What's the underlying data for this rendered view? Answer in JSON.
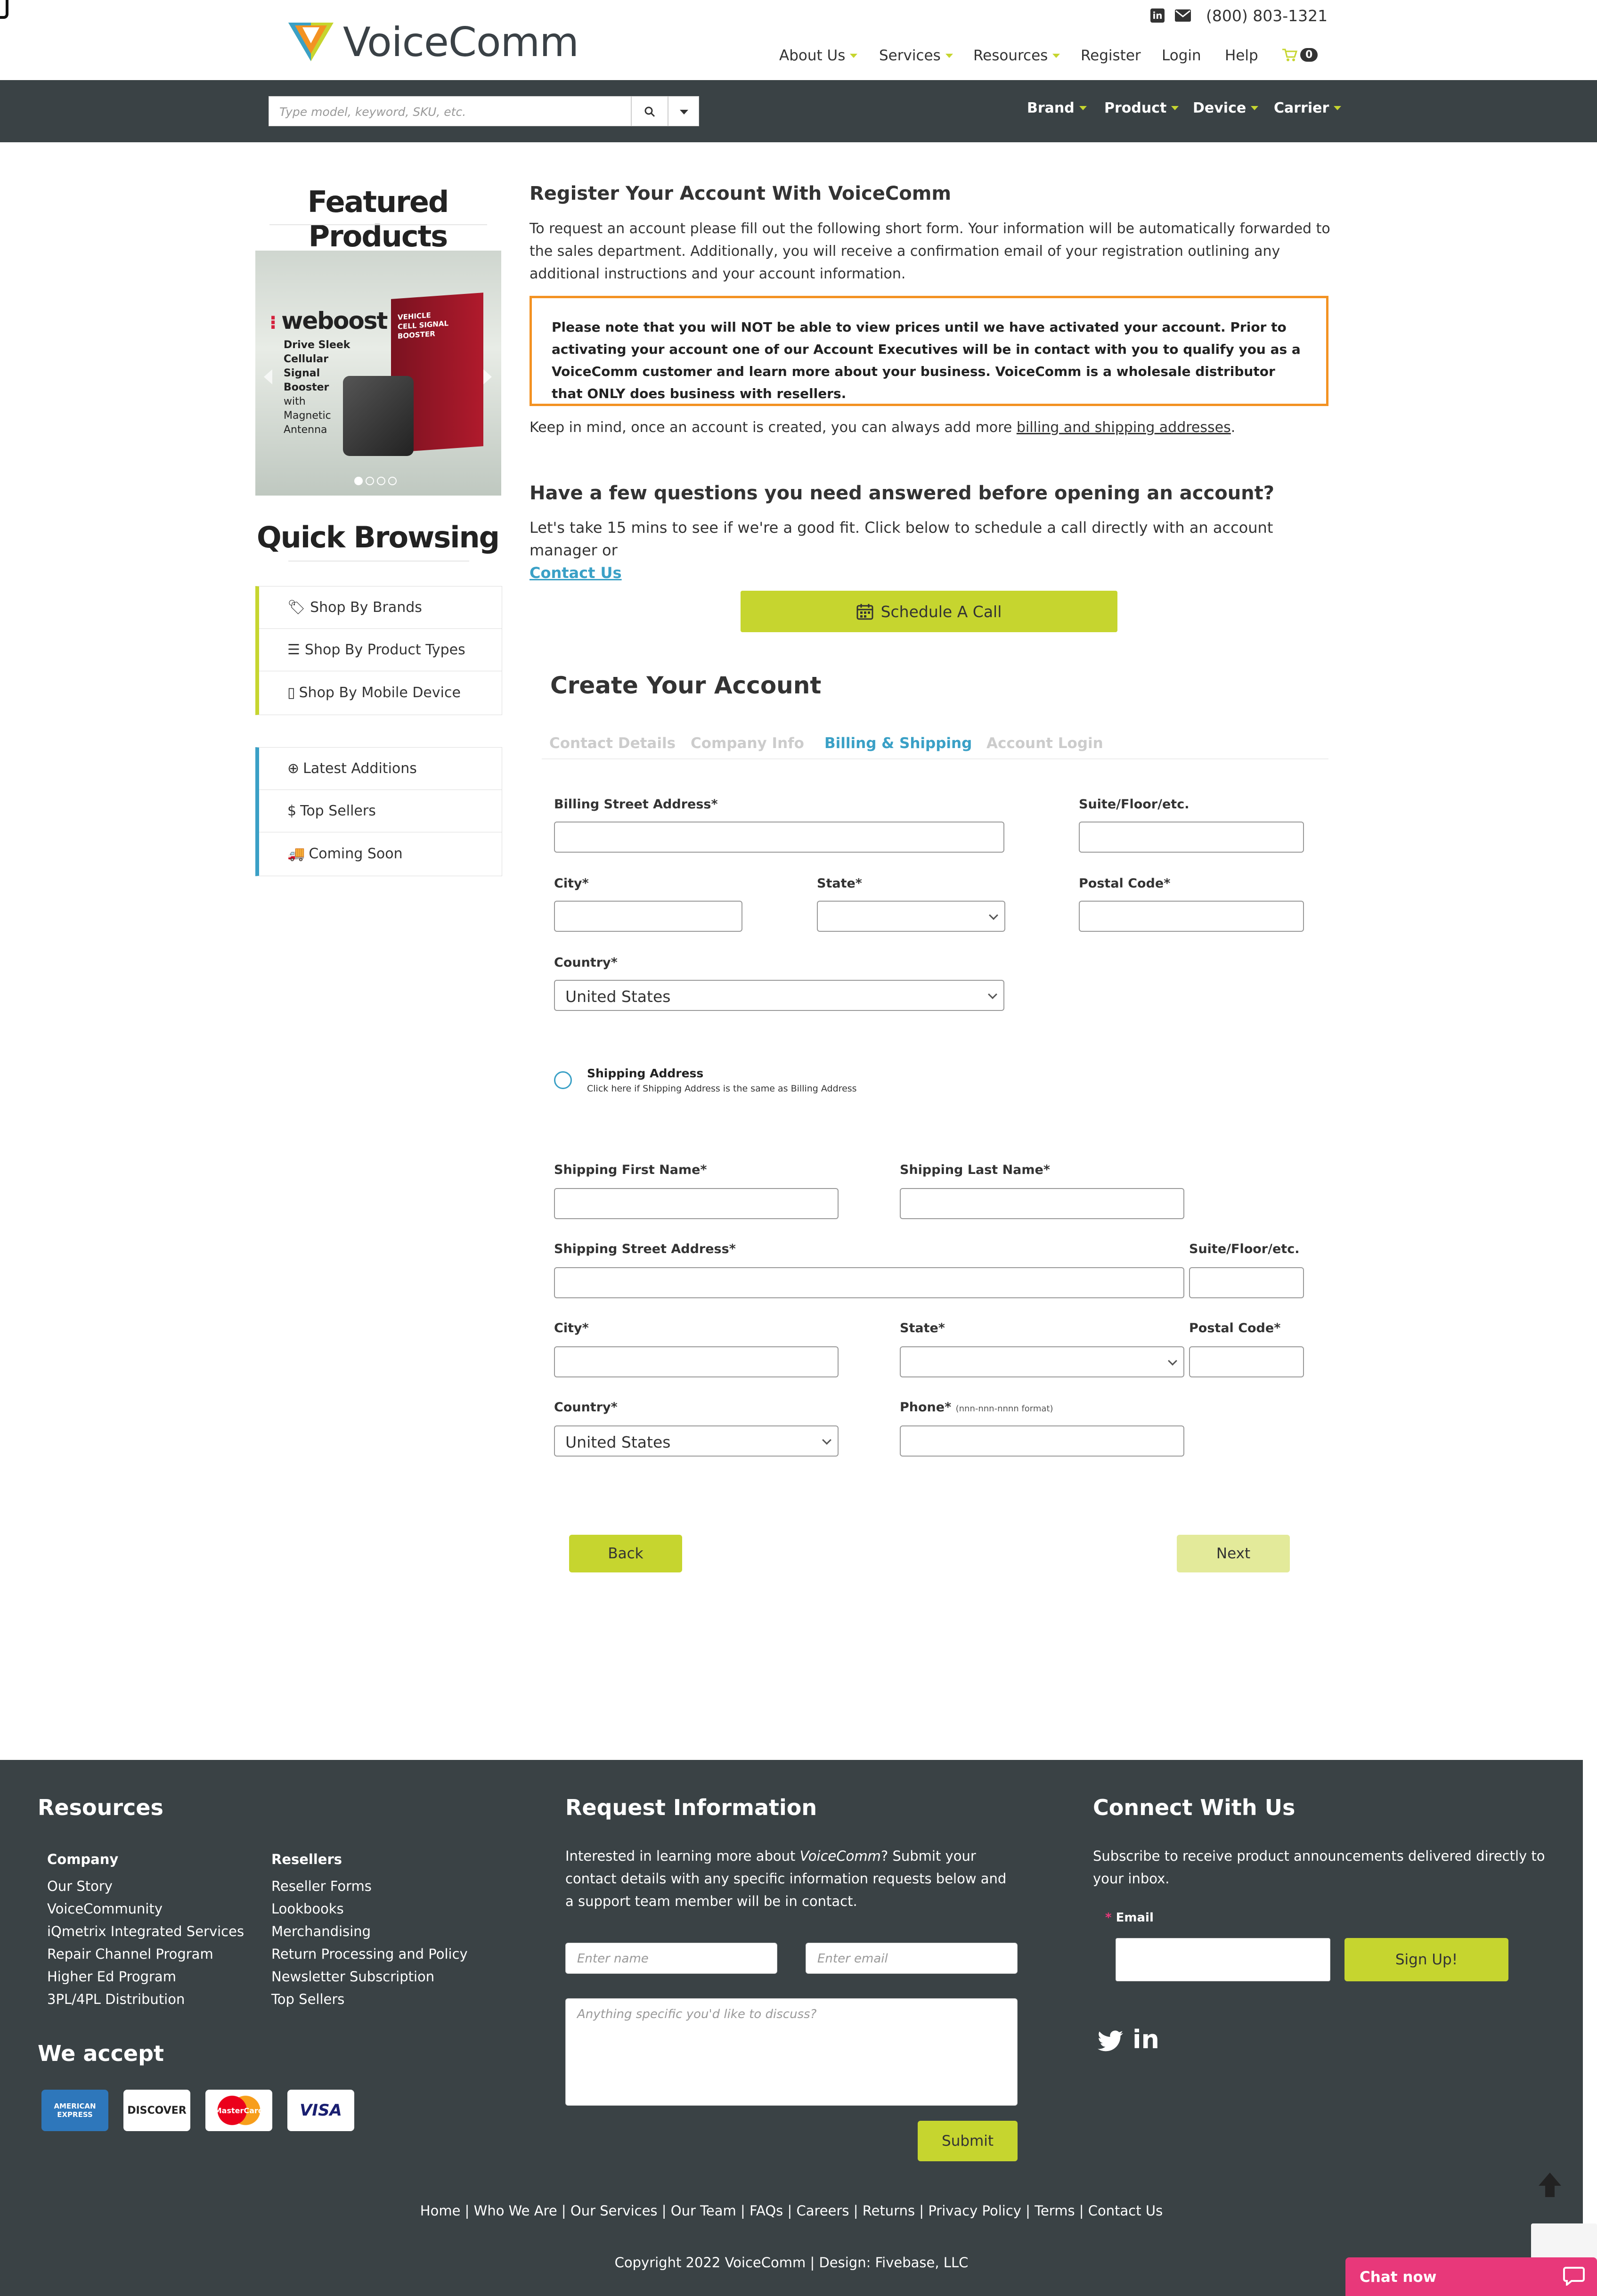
{
  "header": {
    "brand": "VoiceComm",
    "phone": "(800) 803-1321",
    "nav": [
      "About Us",
      "Services",
      "Resources",
      "Register",
      "Login",
      "Help"
    ],
    "cart_count": "0"
  },
  "catbar": {
    "search_placeholder": "Type model, keyword, SKU, etc.",
    "menus": [
      "Brand",
      "Product",
      "Device",
      "Carrier"
    ]
  },
  "sidebar": {
    "featured_title": "Featured Products",
    "carousel": {
      "brand": "weboost",
      "lines": [
        "Drive Sleek",
        "Cellular",
        "Signal",
        "Booster",
        "with",
        "Magnetic",
        "Antenna"
      ],
      "box_text": [
        "VEHICLE",
        "CELL SIGNAL",
        "BOOSTER"
      ]
    },
    "quick_title": "Quick Browsing",
    "list1": [
      "Shop By Brands",
      "Shop By Product Types",
      "Shop By Mobile Device"
    ],
    "list2": [
      "Latest Additions",
      "Top Sellers",
      "Coming Soon"
    ]
  },
  "main": {
    "title": "Register Your Account With VoiceComm",
    "intro": "To request an account please fill out the following short form. Your information will be automatically forwarded to the sales department. Additionally, you will receive a confirmation email of your registration outlining any additional instructions and your account information.",
    "notice": "Please note that you will NOT be able to view prices until we have activated your account. Prior to activating your account one of our Account Executives will be in contact with you to qualify you as a VoiceComm customer and learn more about your business. VoiceComm is a wholesale distributor that ONLY does business with resellers.",
    "keep_in_mind_pre": "Keep in mind, once an account is created, you can always add more ",
    "keep_in_mind_link": "billing and shipping addresses",
    "keep_in_mind_post": ".",
    "questions_title": "Have a few questions you need answered before opening an account?",
    "questions_text": "Let's take 15 mins to see if we're a good fit. Click below to schedule a call directly with an account manager or",
    "contact_link": "Contact Us",
    "schedule_label": "Schedule A Call",
    "create_title": "Create Your Account",
    "tabs": [
      "Contact Details",
      "Company Info",
      "Billing & Shipping",
      "Account Login"
    ]
  },
  "form": {
    "billing_street": "Billing Street Address*",
    "suite": "Suite/Floor/etc.",
    "city": "City*",
    "state": "State*",
    "postal": "Postal Code*",
    "country": "Country*",
    "country_value": "United States",
    "shipping_title": "Shipping Address",
    "shipping_hint": "Click here if Shipping Address is the same as Billing Address",
    "ship_first": "Shipping First Name*",
    "ship_last": "Shipping Last Name*",
    "ship_street": "Shipping Street Address*",
    "phone": "Phone*",
    "phone_hint": "(nnn-nnn-nnnn format)",
    "back": "Back",
    "next": "Next"
  },
  "footer": {
    "resources_title": "Resources",
    "company_title": "Company",
    "company_links": [
      "Our Story",
      "VoiceCommunity",
      "iQmetrix Integrated Services",
      "Repair Channel Program",
      "Higher Ed Program",
      "3PL/4PL Distribution"
    ],
    "resellers_title": "Resellers",
    "reseller_links": [
      "Reseller Forms",
      "Lookbooks",
      "Merchandising",
      "Return Processing and Policy",
      "Newsletter Subscription",
      "Top Sellers"
    ],
    "we_accept": "We accept",
    "cards": [
      "AMERICAN EXPRESS",
      "DISCOVER",
      "MasterCard",
      "VISA"
    ],
    "request_title": "Request Information",
    "request_pre": "Interested in learning more about ",
    "request_em": "VoiceComm",
    "request_post": "? Submit your contact details with any specific information requests below and a support team member will be in contact.",
    "name_ph": "Enter name",
    "email_ph": "Enter email",
    "msg_ph": "Anything specific you'd like to discuss?",
    "submit": "Submit",
    "connect_title": "Connect With Us",
    "connect_text": "Subscribe to receive product announcements delivered directly to your inbox.",
    "email_label": "Email",
    "signup": "Sign Up!",
    "bottom_links": [
      "Home",
      "Who We Are",
      "Our Services",
      "Our Team",
      "FAQs",
      "Careers",
      "Returns",
      "Privacy Policy",
      "Terms",
      "Contact Us"
    ],
    "copyright_pre": "Copyright 2022 ",
    "copyright_brand": "VoiceComm",
    "copyright_post": " | Design: Fivebase, LLC",
    "chat": "Chat now"
  }
}
